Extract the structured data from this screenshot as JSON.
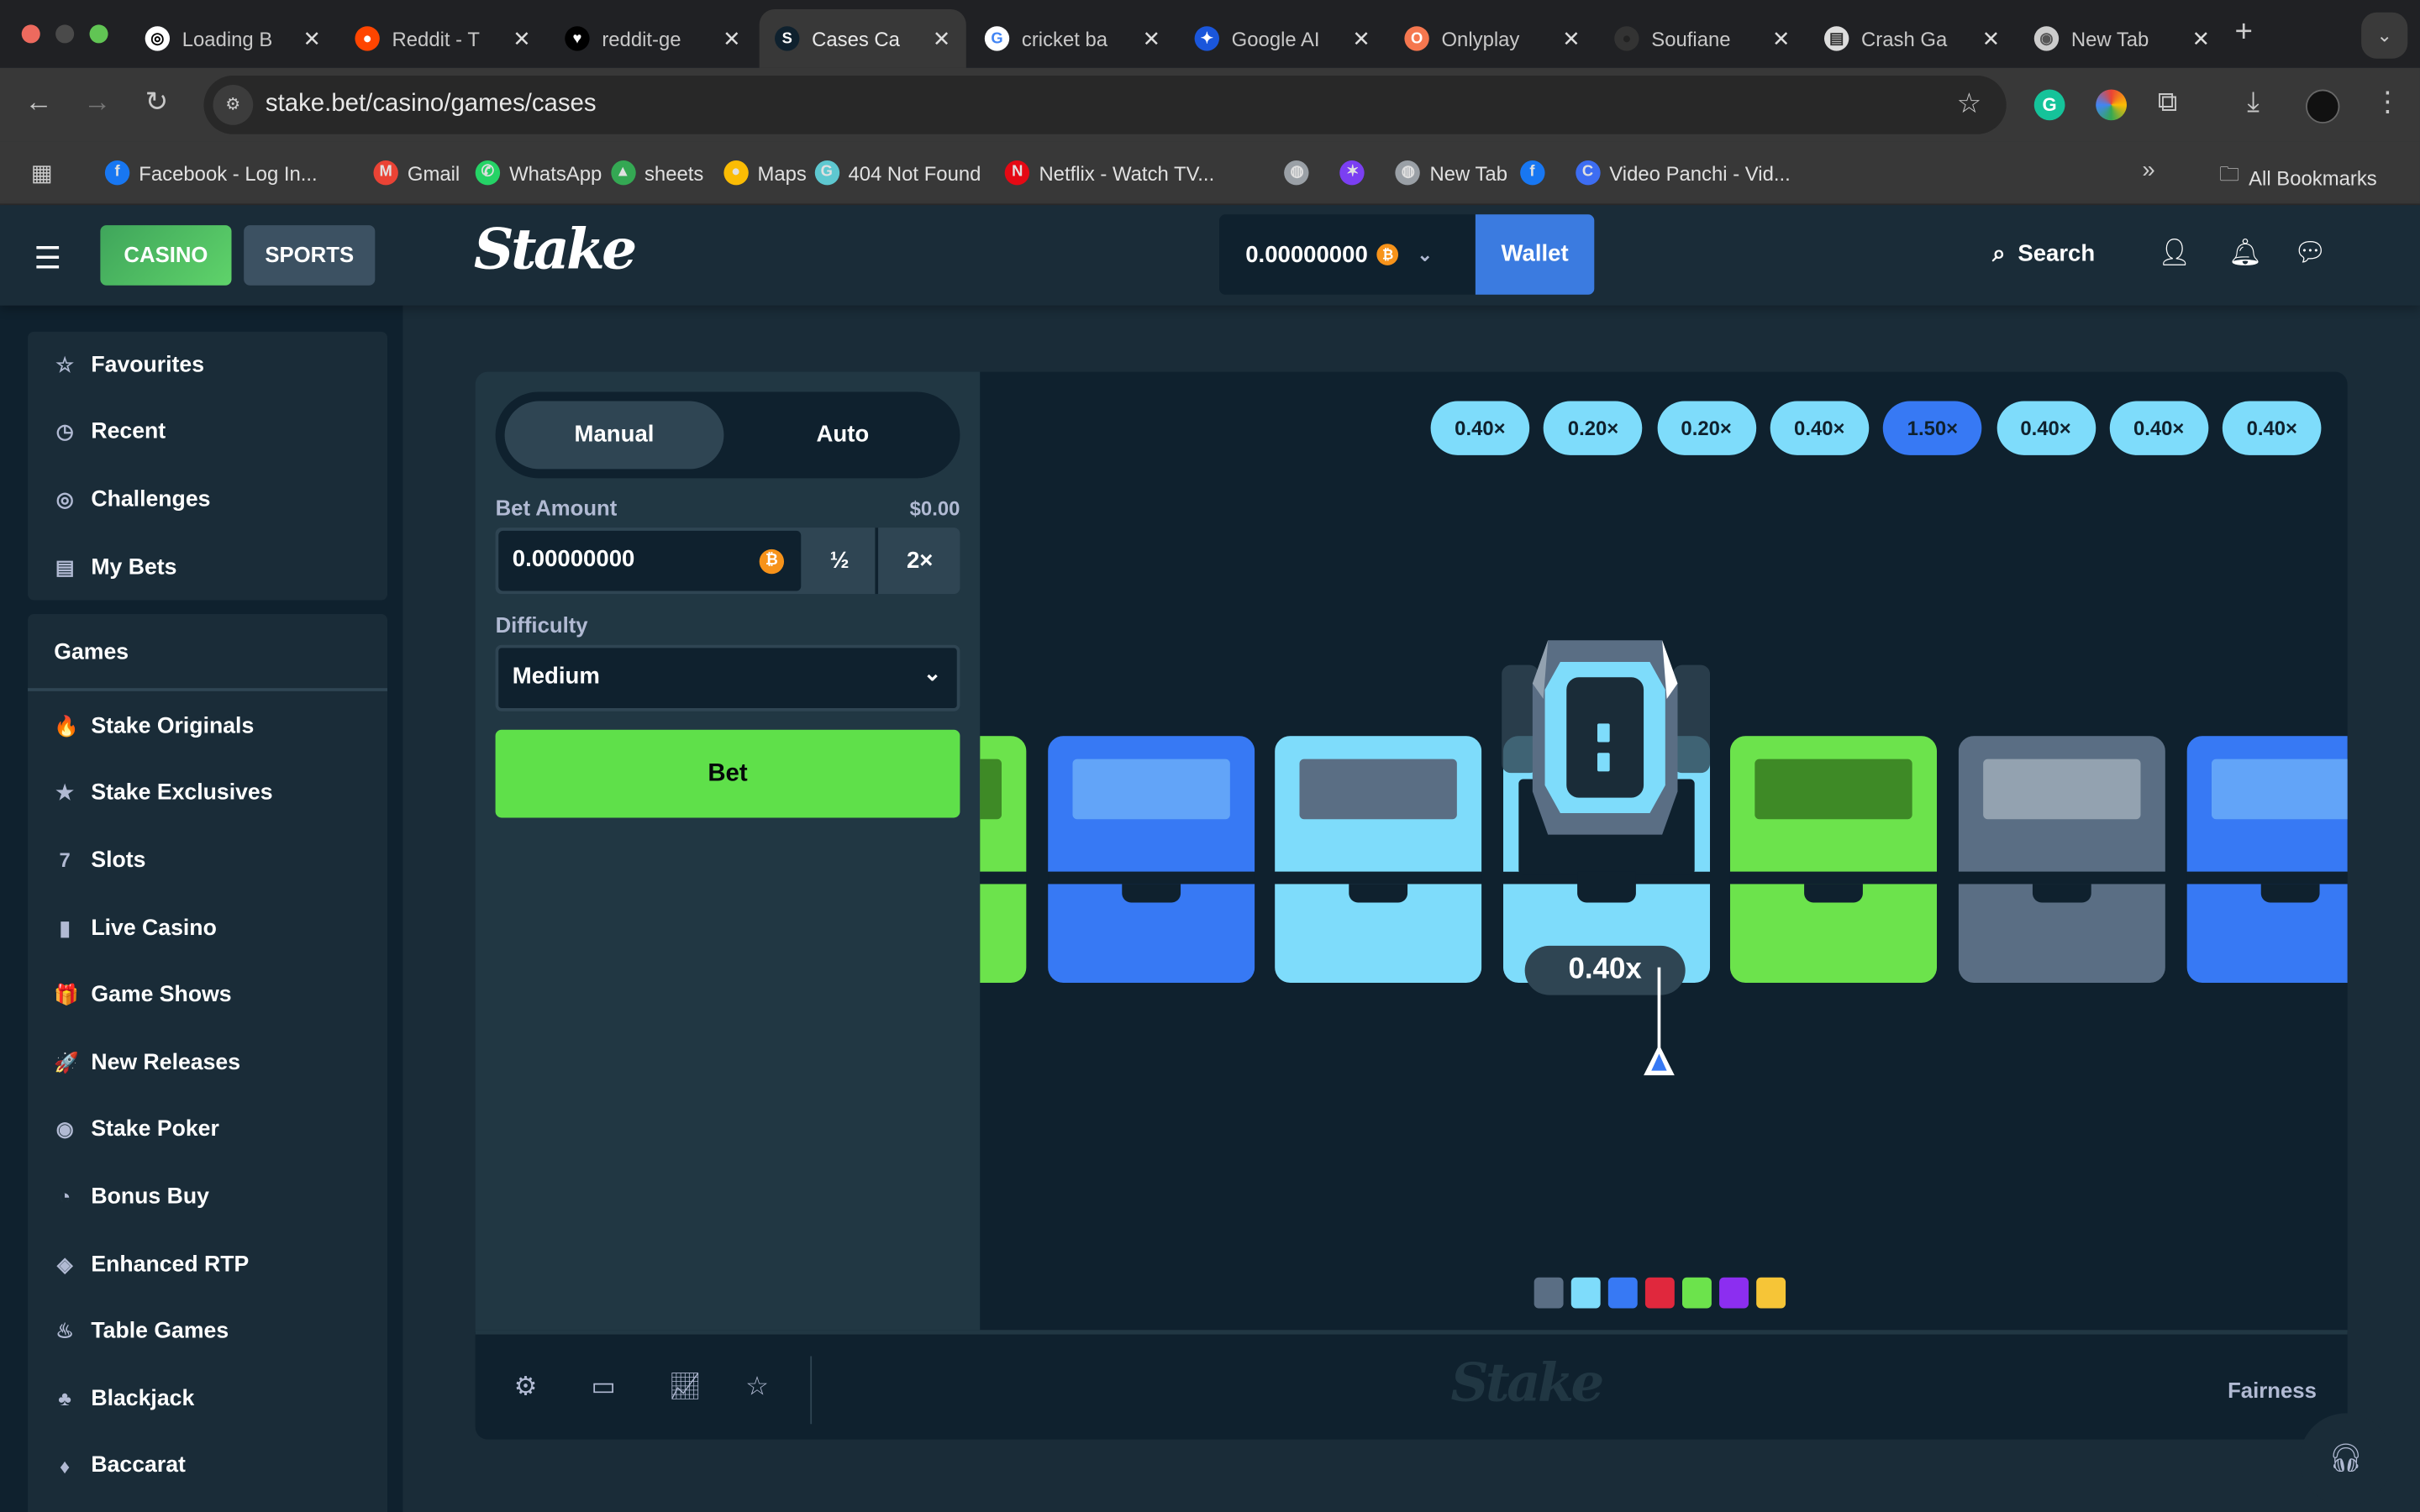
{
  "browser": {
    "tabs": [
      {
        "title": "Loading B",
        "icon": "openai-icon"
      },
      {
        "title": "Reddit - T",
        "icon": "reddit-icon"
      },
      {
        "title": "reddit-ge",
        "icon": "heart-icon"
      },
      {
        "title": "Cases Ca",
        "icon": "stake-icon",
        "active": true
      },
      {
        "title": "cricket ba",
        "icon": "google-icon"
      },
      {
        "title": "Google AI",
        "icon": "google-ai-icon"
      },
      {
        "title": "Onlyplay",
        "icon": "onlyplay-icon"
      },
      {
        "title": "Soufiane",
        "icon": "github-icon"
      },
      {
        "title": "Crash Ga",
        "icon": "crash-icon"
      },
      {
        "title": "New Tab",
        "icon": "chrome-icon"
      }
    ],
    "url": "stake.bet/casino/games/cases",
    "bookmarks": [
      {
        "label": "Facebook - Log In...",
        "color": "#1877f2",
        "glyph": "f"
      },
      {
        "label": "Gmail",
        "color": "#ea4335",
        "glyph": "M"
      },
      {
        "label": "WhatsApp",
        "color": "#25d366",
        "glyph": "✆"
      },
      {
        "label": "sheets",
        "color": "#34a853",
        "glyph": "▲"
      },
      {
        "label": "Maps",
        "color": "#fbbc04",
        "glyph": "●"
      },
      {
        "label": "404 Not Found",
        "color": "#5ec8d0",
        "glyph": "G"
      },
      {
        "label": "Netflix - Watch TV...",
        "color": "#e50914",
        "glyph": "N"
      },
      {
        "label": "",
        "color": "#9aa0a6",
        "glyph": "◍"
      },
      {
        "label": "",
        "color": "#7b3ff2",
        "glyph": "✶"
      },
      {
        "label": "New Tab",
        "color": "#9aa0a6",
        "glyph": "◍"
      },
      {
        "label": "",
        "color": "#1877f2",
        "glyph": "f"
      },
      {
        "label": "Video Panchi - Vid...",
        "color": "#3d6df2",
        "glyph": "C"
      }
    ],
    "all_bookmarks": "All Bookmarks"
  },
  "header": {
    "casino": "CASINO",
    "sports": "SPORTS",
    "logo": "Stake",
    "balance": "0.00000000",
    "wallet": "Wallet",
    "search": "Search"
  },
  "sidebar": {
    "top": [
      {
        "label": "Favourites",
        "icon": "☆"
      },
      {
        "label": "Recent",
        "icon": "◷"
      },
      {
        "label": "Challenges",
        "icon": "◎"
      },
      {
        "label": "My Bets",
        "icon": "▤"
      }
    ],
    "games_title": "Games",
    "games": [
      {
        "label": "Stake Originals",
        "icon": "🔥"
      },
      {
        "label": "Stake Exclusives",
        "icon": "★"
      },
      {
        "label": "Slots",
        "icon": "7"
      },
      {
        "label": "Live Casino",
        "icon": "▮"
      },
      {
        "label": "Game Shows",
        "icon": "🎁"
      },
      {
        "label": "New Releases",
        "icon": "🚀"
      },
      {
        "label": "Stake Poker",
        "icon": "◉"
      },
      {
        "label": "Bonus Buy",
        "icon": "◔"
      },
      {
        "label": "Enhanced RTP",
        "icon": "◈"
      },
      {
        "label": "Table Games",
        "icon": "♨"
      },
      {
        "label": "Blackjack",
        "icon": "♣"
      },
      {
        "label": "Baccarat",
        "icon": "♦"
      }
    ]
  },
  "controls": {
    "manual": "Manual",
    "auto": "Auto",
    "bet_amount_label": "Bet Amount",
    "bet_amount_usd": "$0.00",
    "bet_amount": "0.00000000",
    "half": "½",
    "double": "2×",
    "difficulty_label": "Difficulty",
    "difficulty": "Medium",
    "bet": "Bet"
  },
  "game": {
    "history": [
      {
        "value": "0.40×",
        "color": "#7edcfb"
      },
      {
        "value": "0.20×",
        "color": "#7edcfb"
      },
      {
        "value": "0.20×",
        "color": "#7edcfb"
      },
      {
        "value": "0.40×",
        "color": "#7edcfb"
      },
      {
        "value": "1.50×",
        "color": "#3779f4"
      },
      {
        "value": "0.40×",
        "color": "#7edcfb"
      },
      {
        "value": "0.40×",
        "color": "#7edcfb"
      },
      {
        "value": "0.40×",
        "color": "#7edcfb"
      }
    ],
    "cases": [
      {
        "color": "#6ce34c",
        "window": "#3e8a26"
      },
      {
        "color": "#3779f4",
        "window": "#62a4f8"
      },
      {
        "color": "#7edcfb",
        "window": "#5a6e84"
      },
      {
        "color": "#7edcfb",
        "window": "#0f212e",
        "opened": true
      },
      {
        "color": "#6ce34c",
        "window": "#3e8a26"
      },
      {
        "color": "#5a6e84",
        "window": "#93a2b0"
      },
      {
        "color": "#3779f4",
        "window": "#62a4f8"
      }
    ],
    "result": "0.40x",
    "legend_colors": [
      "#5a6e84",
      "#7edcfb",
      "#3779f4",
      "#e0283d",
      "#6ce34c",
      "#8c2ef0",
      "#f6c537"
    ]
  },
  "footer": {
    "logo": "Stake",
    "fairness": "Fairness"
  }
}
